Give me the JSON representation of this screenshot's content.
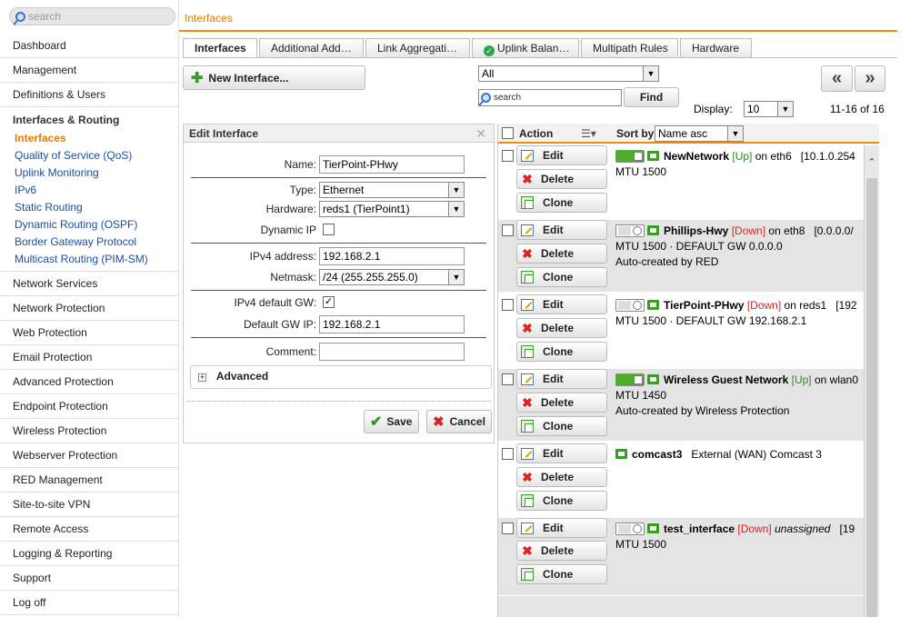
{
  "search": {
    "placeholder": "search"
  },
  "sidebar": {
    "top_items": [
      "Dashboard",
      "Management",
      "Definitions & Users"
    ],
    "group": {
      "title": "Interfaces & Routing",
      "subs": [
        "Interfaces",
        "Quality of Service (QoS)",
        "Uplink Monitoring",
        "IPv6",
        "Static Routing",
        "Dynamic Routing (OSPF)",
        "Border Gateway Protocol",
        "Multicast Routing (PIM-SM)"
      ]
    },
    "bottom_items": [
      "Network Services",
      "Network Protection",
      "Web Protection",
      "Email Protection",
      "Advanced Protection",
      "Endpoint Protection",
      "Wireless Protection",
      "Webserver Protection",
      "RED Management",
      "Site-to-site VPN",
      "Remote Access",
      "Logging & Reporting",
      "Support",
      "Log off"
    ]
  },
  "breadcrumb": "Interfaces",
  "tabs": [
    "Interfaces",
    "Additional Add…",
    "Link Aggregati…",
    "Uplink Balan…",
    "Multipath Rules",
    "Hardware"
  ],
  "toolbar": {
    "new_label": "New Interface...",
    "filter_value": "All",
    "find_placeholder": "search",
    "find_label": "Find",
    "prev": "«",
    "next": "»",
    "display_label": "Display:",
    "display_value": "10",
    "range": "11-16 of 16"
  },
  "edit": {
    "title": "Edit Interface",
    "name_label": "Name:",
    "name_value": "TierPoint-PHwy",
    "type_label": "Type:",
    "type_value": "Ethernet",
    "hardware_label": "Hardware:",
    "hardware_value": "reds1 (TierPoint1)",
    "dynip_label": "Dynamic IP",
    "ipv4_label": "IPv4 address:",
    "ipv4_value": "192.168.2.1",
    "netmask_label": "Netmask:",
    "netmask_value": "/24 (255.255.255.0)",
    "defgw_label": "IPv4 default GW:",
    "gwip_label": "Default GW IP:",
    "gwip_value": "192.168.2.1",
    "comment_label": "Comment:",
    "comment_value": "",
    "advanced_label": "Advanced",
    "save_label": "Save",
    "cancel_label": "Cancel"
  },
  "list": {
    "action_label": "Action",
    "sortby_label": "Sort by:",
    "sortby_value": "Name asc",
    "edit_label": "Edit",
    "delete_label": "Delete",
    "clone_label": "Clone",
    "rows": [
      {
        "name": "NewNetwork",
        "status": "[Up]",
        "on": "on eth6",
        "addr": "[10.1.0.254",
        "line2": "MTU 1500",
        "line3": ""
      },
      {
        "name": "Phillips-Hwy",
        "status": "[Down]",
        "on": "on eth8",
        "addr": "[0.0.0.0/",
        "line2": "MTU 1500 · DEFAULT GW 0.0.0.0",
        "line3": "Auto-created by RED"
      },
      {
        "name": "TierPoint-PHwy",
        "status": "[Down]",
        "on": "on reds1",
        "addr": "[192",
        "line2": "MTU 1500 · DEFAULT GW 192.168.2.1",
        "line3": ""
      },
      {
        "name": "Wireless Guest Network",
        "status": "[Up]",
        "on": "on wlan0",
        "addr": "",
        "line2": "MTU 1450",
        "line3": "Auto-created by Wireless Protection"
      },
      {
        "name": "comcast3",
        "status": "",
        "on": "External (WAN) Comcast 3",
        "addr": "",
        "line2": "",
        "line3": ""
      },
      {
        "name": "test_interface",
        "status": "[Down]",
        "on": "unassigned",
        "addr": "[19",
        "line2": "MTU 1500",
        "line3": ""
      }
    ]
  }
}
